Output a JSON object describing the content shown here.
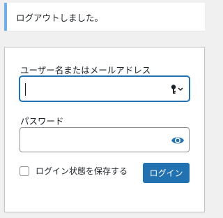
{
  "notice": {
    "message": "ログアウトしました。",
    "accent_color": "#72aee6"
  },
  "login_form": {
    "username_label": "ユーザー名またはメールアドレス",
    "username_value": "",
    "password_label": "パスワード",
    "password_value": "",
    "remember_label": "ログイン状態を保存する",
    "remember_checked": false,
    "submit_label": "ログイン",
    "accent_color": "#2271b1",
    "icons": {
      "username_field": "key-icon",
      "password_field": "eye-icon"
    }
  }
}
